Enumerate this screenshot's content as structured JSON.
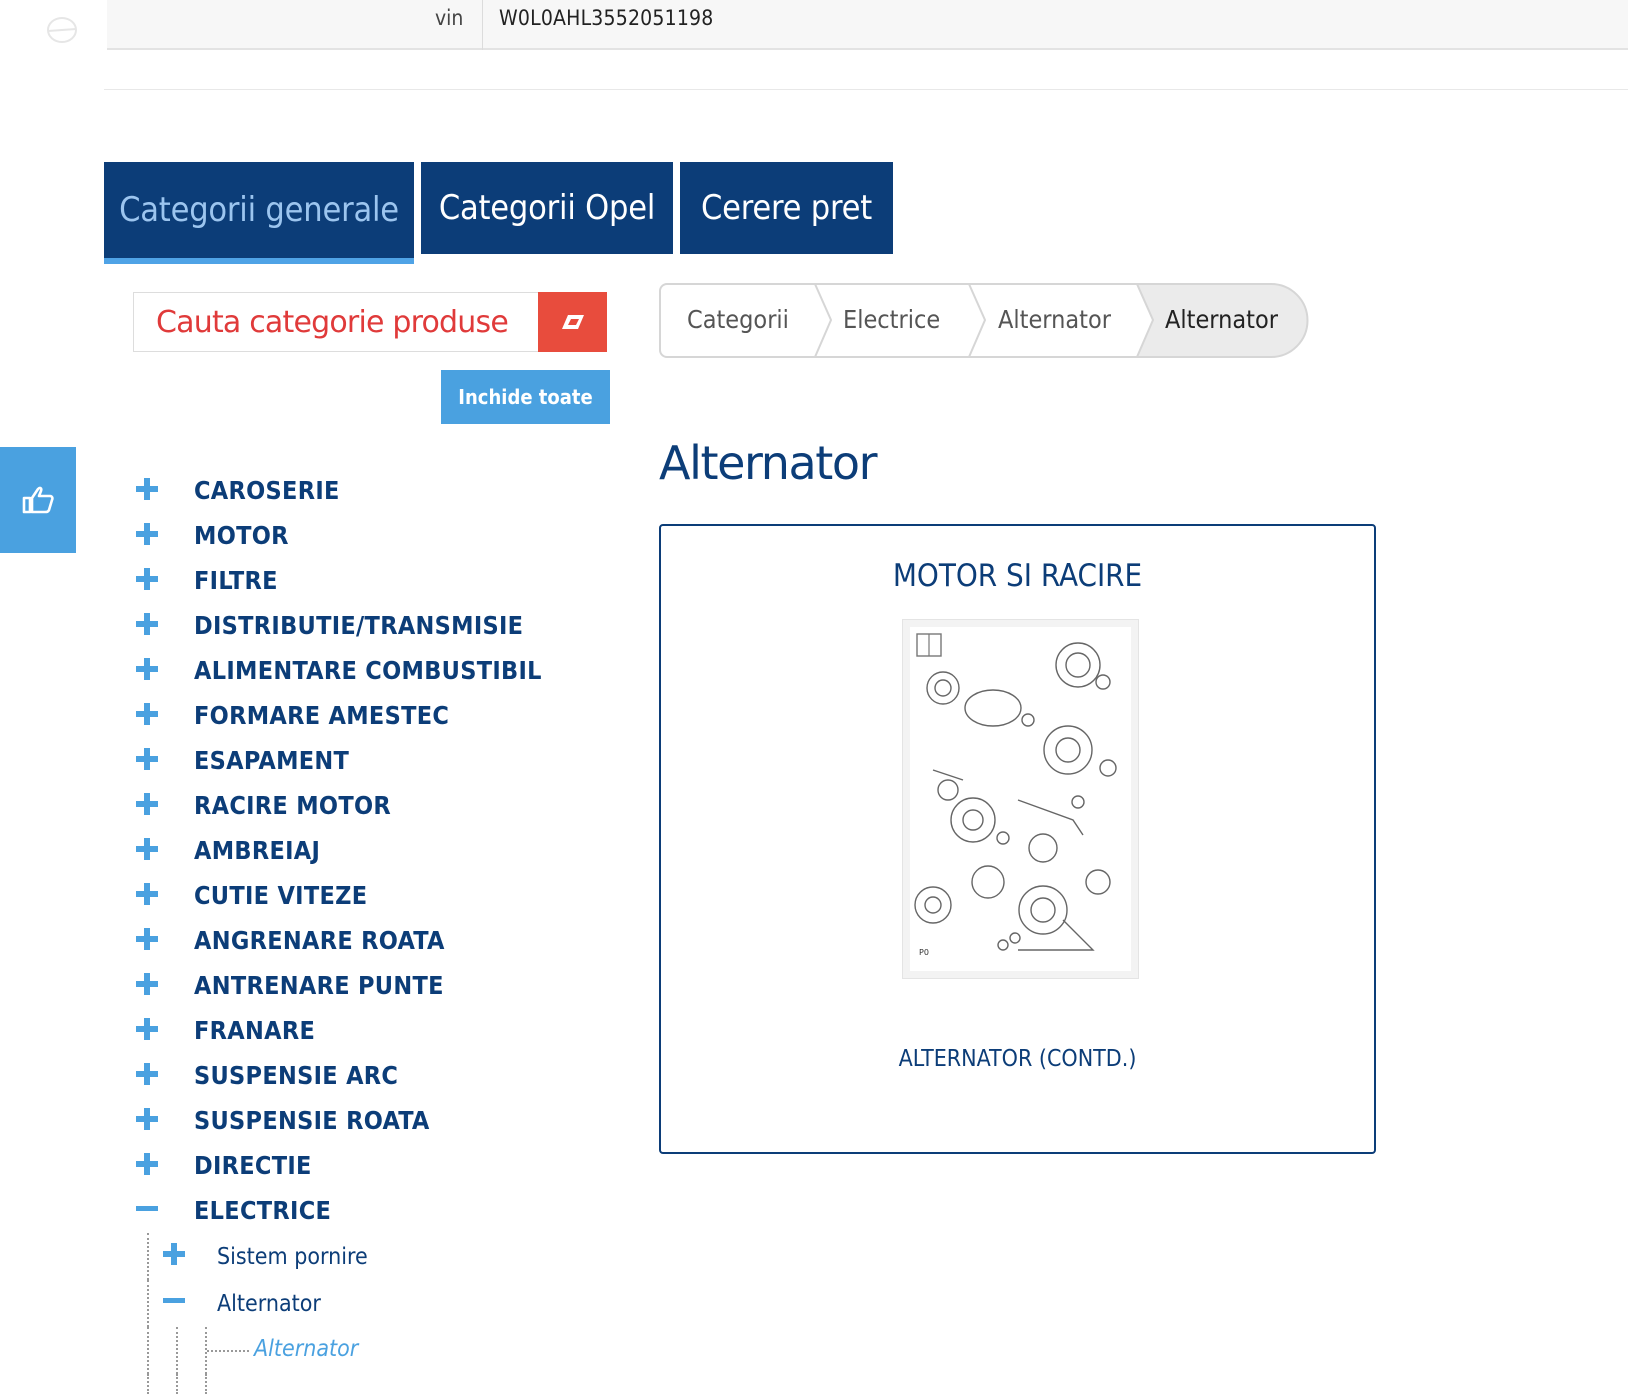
{
  "vin": {
    "label": "vin",
    "value": "W0L0AHL3552051198"
  },
  "tabs": [
    {
      "label": "Categorii generale",
      "active": true
    },
    {
      "label": "Categorii Opel",
      "active": false
    },
    {
      "label": "Cerere pret",
      "active": false
    }
  ],
  "search": {
    "placeholder": "Cauta categorie produse",
    "clear_icon": "eraser-icon"
  },
  "close_all_label": "Inchide toate",
  "side_button_icon": "thumbs-up-icon",
  "categories": [
    "CAROSERIE",
    "MOTOR",
    "FILTRE",
    "DISTRIBUTIE/TRANSMISIE",
    "ALIMENTARE COMBUSTIBIL",
    "FORMARE AMESTEC",
    "ESAPAMENT",
    "RACIRE MOTOR",
    "AMBREIAJ",
    "CUTIE VITEZE",
    "ANGRENARE ROATA",
    "ANTRENARE PUNTE",
    "FRANARE",
    "SUSPENSIE ARC",
    "SUSPENSIE ROATA",
    "DIRECTIE",
    "ELECTRICE"
  ],
  "expanded_category": "ELECTRICE",
  "subcategories": [
    {
      "label": "Sistem pornire",
      "expanded": false
    },
    {
      "label": "Alternator",
      "expanded": true
    }
  ],
  "active_leaf": "Alternator",
  "breadcrumb": [
    "Categorii",
    "Electrice",
    "Alternator",
    "Alternator"
  ],
  "page_title": "Alternator",
  "card": {
    "title": "MOTOR SI RACIRE",
    "caption": "ALTERNATOR (CONTD.)"
  },
  "colors": {
    "navy": "#0c3d78",
    "accent_blue": "#4aa1e0",
    "red": "#e84c3d"
  }
}
